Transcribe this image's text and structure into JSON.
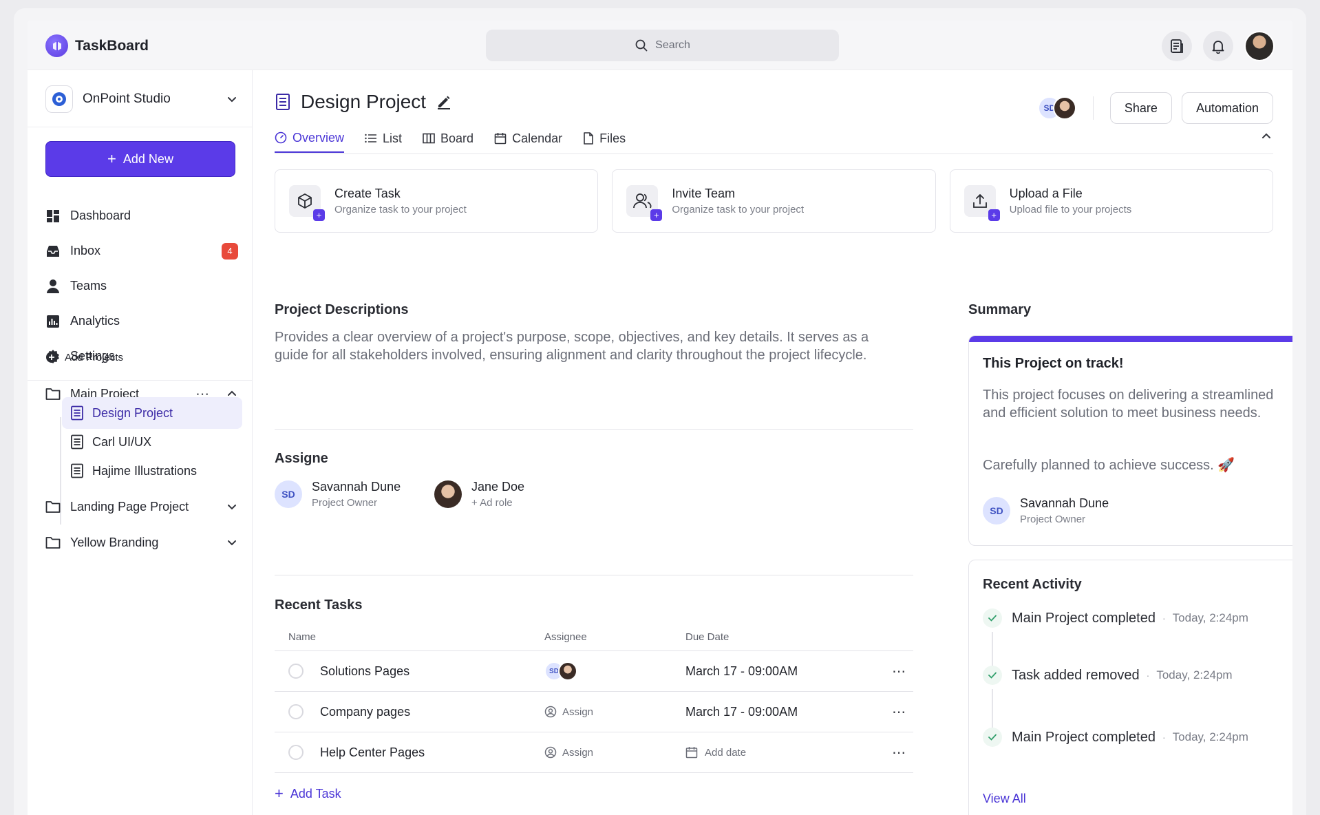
{
  "app": {
    "name": "TaskBoard"
  },
  "search": {
    "placeholder": "Search"
  },
  "sidebar": {
    "workspace": "OnPoint Studio",
    "add_new": "Add New",
    "nav": [
      {
        "label": "Dashboard",
        "icon": "dashboard-icon"
      },
      {
        "label": "Inbox",
        "icon": "inbox-icon",
        "badge": "4"
      },
      {
        "label": "Teams",
        "icon": "user-icon"
      },
      {
        "label": "Analytics",
        "icon": "analytics-icon"
      },
      {
        "label": "Settings",
        "icon": "gear-icon"
      }
    ],
    "add_projects": "Add Projects",
    "projects": [
      {
        "label": "Main Project",
        "more": "⋯"
      },
      {
        "label": "Landing Page Project"
      },
      {
        "label": "Yellow Branding"
      }
    ],
    "sub_projects": [
      "Design Project",
      "Carl UI/UX",
      "Hajime Illustrations"
    ]
  },
  "header": {
    "title": "Design Project",
    "members": {
      "initials": "SD"
    },
    "share": "Share",
    "automation": "Automation"
  },
  "tabs": [
    "Overview",
    "List",
    "Board",
    "Calendar",
    "Files"
  ],
  "quick_actions": [
    {
      "title": "Create Task",
      "subtitle": "Organize task to your project",
      "plus": "+"
    },
    {
      "title": "Invite Team",
      "subtitle": "Organize task to your project",
      "plus": "+"
    },
    {
      "title": "Upload a File",
      "subtitle": "Upload file to your projects",
      "plus": "+"
    }
  ],
  "description": {
    "title": "Project Descriptions",
    "text": "Provides a clear overview of a project's purpose, scope, objectives, and key details. It serves as a guide for all stakeholders involved, ensuring alignment and clarity throughout the project lifecycle."
  },
  "assignee": {
    "title": "Assigne",
    "people": [
      {
        "initials": "SD",
        "name": "Savannah Dune",
        "role": "Project Owner"
      },
      {
        "name": "Jane Doe",
        "role": "+ Ad role"
      }
    ]
  },
  "recent_tasks": {
    "title": "Recent Tasks",
    "columns": [
      "Name",
      "Assignee",
      "Due Date"
    ],
    "rows": [
      {
        "name": "Solutions Pages",
        "assignee_initials": "SD",
        "due": "March 17 - 09:00AM",
        "more": "⋯"
      },
      {
        "name": "Company pages",
        "assignee": "Assign",
        "due": "March 17 - 09:00AM",
        "more": "⋯"
      },
      {
        "name": "Help Center Pages",
        "assignee": "Assign",
        "due": "Add date",
        "more": "⋯"
      }
    ],
    "add_task": "Add Task"
  },
  "summary": {
    "title": "Summary",
    "card_title": "This Project on track!",
    "text": "This project focuses on delivering a streamlined and efficient solution to meet business needs.",
    "text2": "Carefully planned to achieve success. 🚀",
    "owner": {
      "initials": "SD",
      "name": "Savannah Dune",
      "role": "Project Owner"
    }
  },
  "activity": {
    "title": "Recent Activity",
    "dot": "·",
    "items": [
      {
        "text": "Main Project completed",
        "time": "Today, 2:24pm"
      },
      {
        "text": "Task added removed",
        "time": "Today, 2:24pm"
      },
      {
        "text": "Main Project completed",
        "time": "Today, 2:24pm"
      }
    ],
    "view_all": "View All"
  },
  "colors": {
    "accent": "#5b3be8",
    "badge": "#e84a3b",
    "check": "#2f9e6a"
  }
}
